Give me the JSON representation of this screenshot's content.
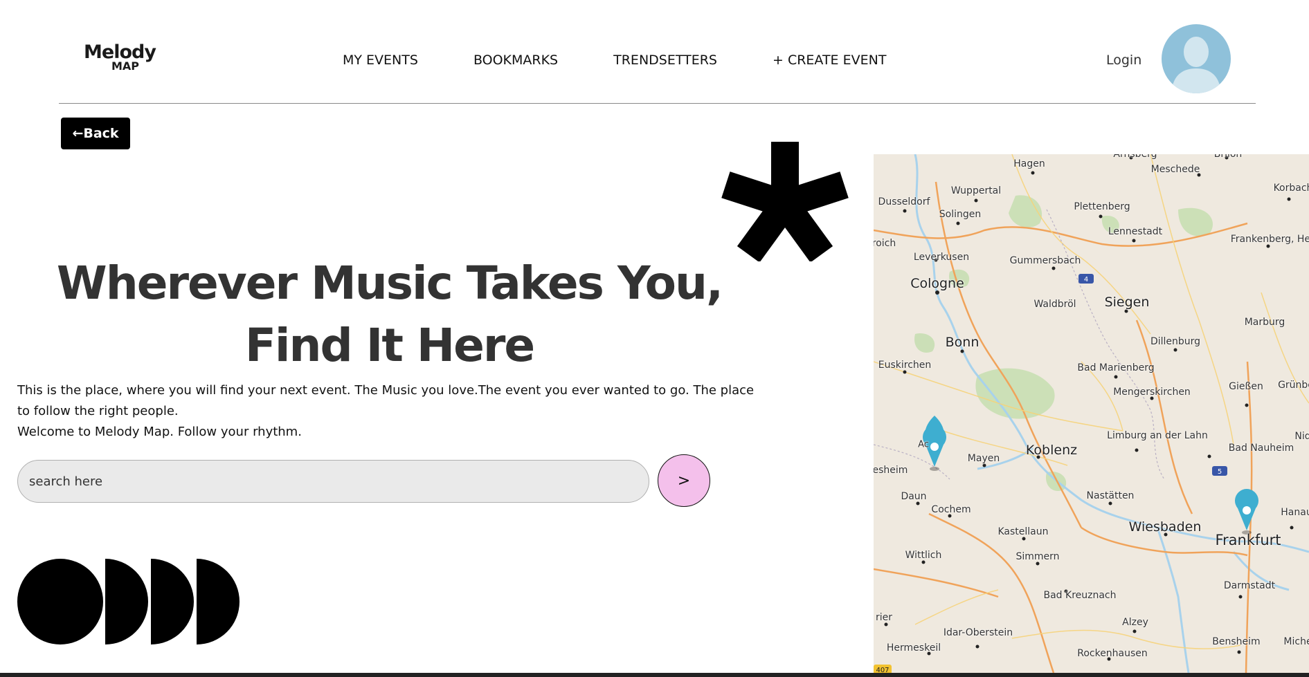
{
  "logo": {
    "line1": "Melody",
    "line2": "MAP"
  },
  "nav": {
    "items": [
      {
        "label": "MY EVENTS"
      },
      {
        "label": "BOOKMARKS"
      },
      {
        "label": "TRENDSETTERS"
      },
      {
        "label": "+ CREATE EVENT"
      }
    ],
    "login_label": "Login"
  },
  "back_label": "←Back",
  "hero": {
    "title_line1": "Wherever Music Takes You,",
    "title_line2": "Find It Here",
    "desc_line1": "This is the place, where you will find your next event. The Music you love.The event you ever wanted to go. The place to follow the right people.",
    "desc_line2": "Welcome to Melody Map. Follow your rhythm."
  },
  "search": {
    "placeholder": "search here",
    "button_label": ">"
  },
  "map": {
    "cities": [
      {
        "name": "Hagen"
      },
      {
        "name": "Arnsberg"
      },
      {
        "name": "Meschede"
      },
      {
        "name": "Brilon"
      },
      {
        "name": "Wuppertal"
      },
      {
        "name": "Korbach"
      },
      {
        "name": "Dusseldorf"
      },
      {
        "name": "Solingen"
      },
      {
        "name": "Plettenberg"
      },
      {
        "name": "Lennestadt"
      },
      {
        "name": "Frankenberg, Hesse"
      },
      {
        "name": "roich"
      },
      {
        "name": "Leverkusen"
      },
      {
        "name": "Gummersbach"
      },
      {
        "name": "Cologne"
      },
      {
        "name": "Waldbröl"
      },
      {
        "name": "Siegen"
      },
      {
        "name": "Marburg"
      },
      {
        "name": "Bonn"
      },
      {
        "name": "Dillenburg"
      },
      {
        "name": "Euskirchen"
      },
      {
        "name": "Bad Marienberg"
      },
      {
        "name": "Mengerskirchen"
      },
      {
        "name": "Gießen"
      },
      {
        "name": "Grünbe"
      },
      {
        "name": "Limburg an der Lahn"
      },
      {
        "name": "Koblenz"
      },
      {
        "name": "Mayen"
      },
      {
        "name": "Bad Nauheim"
      },
      {
        "name": "Nid"
      },
      {
        "name": "lesheim"
      },
      {
        "name": "Daun"
      },
      {
        "name": "Nastätten"
      },
      {
        "name": "Cochem"
      },
      {
        "name": "Hanau"
      },
      {
        "name": "Kastellaun"
      },
      {
        "name": "Wiesbaden"
      },
      {
        "name": "Frankfurt"
      },
      {
        "name": "Wittlich"
      },
      {
        "name": "Simmern"
      },
      {
        "name": "Darmstadt"
      },
      {
        "name": "Bad Kreuznach"
      },
      {
        "name": "rier"
      },
      {
        "name": "Alzey"
      },
      {
        "name": "Idar-Oberstein"
      },
      {
        "name": "Bensheim"
      },
      {
        "name": "Miche"
      },
      {
        "name": "Hermeskeil"
      },
      {
        "name": "Rockenhausen"
      },
      {
        "name": "Ac"
      }
    ],
    "road_shields": [
      "4",
      "5",
      "407"
    ],
    "colors": {
      "land": "#efe9df",
      "forest": "#c8dfb3",
      "water": "#a8d2ec",
      "motorway": "#f0a35a",
      "road": "#f6d37a",
      "pin": "#3eaed0"
    }
  },
  "colors": {
    "search_button": "#f4c0eb",
    "back_button": "#000000",
    "headline": "#333333",
    "avatar": "#8fc1da"
  }
}
